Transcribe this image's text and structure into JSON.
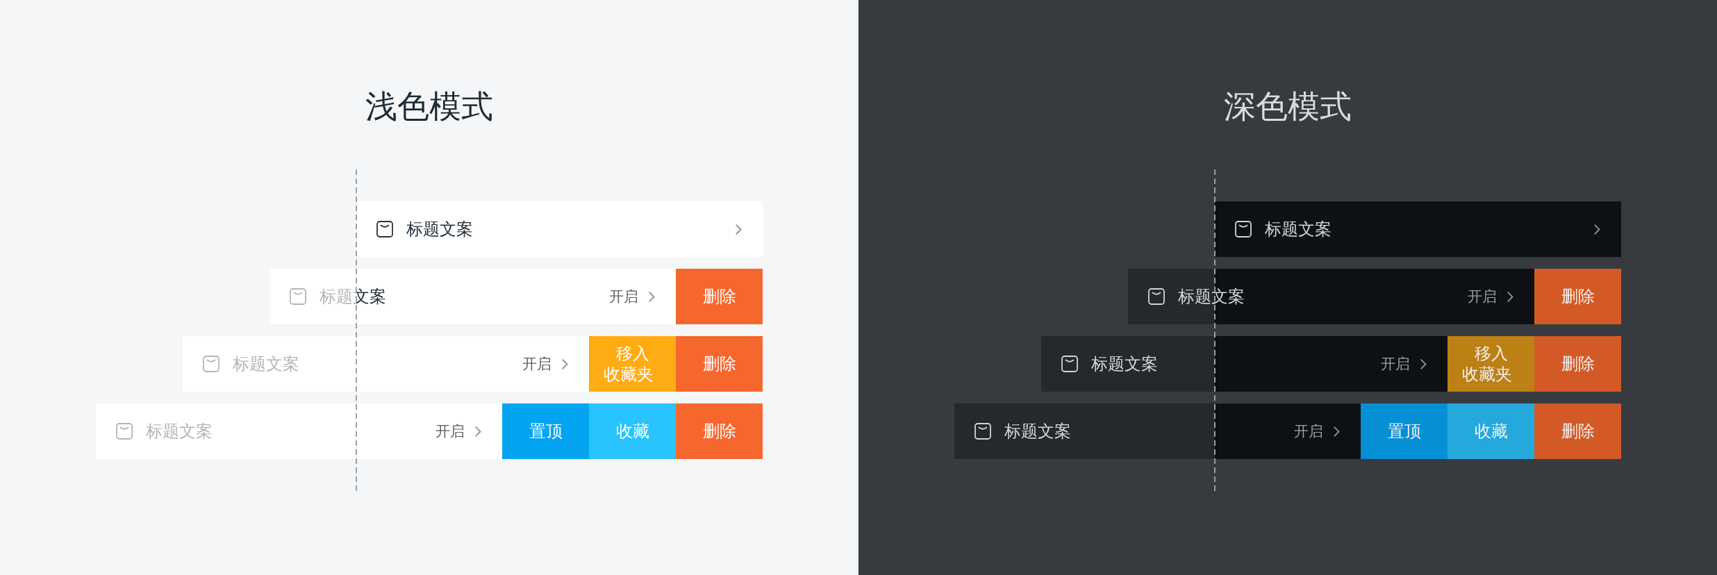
{
  "panels": [
    {
      "title": "浅色模式",
      "kind": "light",
      "rows": [
        {
          "title": "标题文案"
        },
        {
          "title": "标题文案",
          "status": "开启",
          "actions": [
            {
              "kind": "delete",
              "label": "删除"
            }
          ]
        },
        {
          "title": "标题文案",
          "status": "开启",
          "actions": [
            {
              "kind": "move",
              "label": "移入收藏夹"
            },
            {
              "kind": "delete",
              "label": "删除"
            }
          ]
        },
        {
          "title": "标题文案",
          "status": "开启",
          "actions": [
            {
              "kind": "pin",
              "label": "置顶"
            },
            {
              "kind": "favorite",
              "label": "收藏"
            },
            {
              "kind": "delete",
              "label": "删除"
            }
          ]
        }
      ]
    },
    {
      "title": "深色模式",
      "kind": "dark",
      "rows": [
        {
          "title": "标题文案"
        },
        {
          "title": "标题文案",
          "status": "开启",
          "actions": [
            {
              "kind": "delete",
              "label": "删除"
            }
          ]
        },
        {
          "title": "标题文案",
          "status": "开启",
          "actions": [
            {
              "kind": "move",
              "label": "移入收藏夹"
            },
            {
              "kind": "delete",
              "label": "删除"
            }
          ]
        },
        {
          "title": "标题文案",
          "status": "开启",
          "actions": [
            {
              "kind": "pin",
              "label": "置顶"
            },
            {
              "kind": "favorite",
              "label": "收藏"
            },
            {
              "kind": "delete",
              "label": "删除"
            }
          ]
        }
      ]
    }
  ]
}
